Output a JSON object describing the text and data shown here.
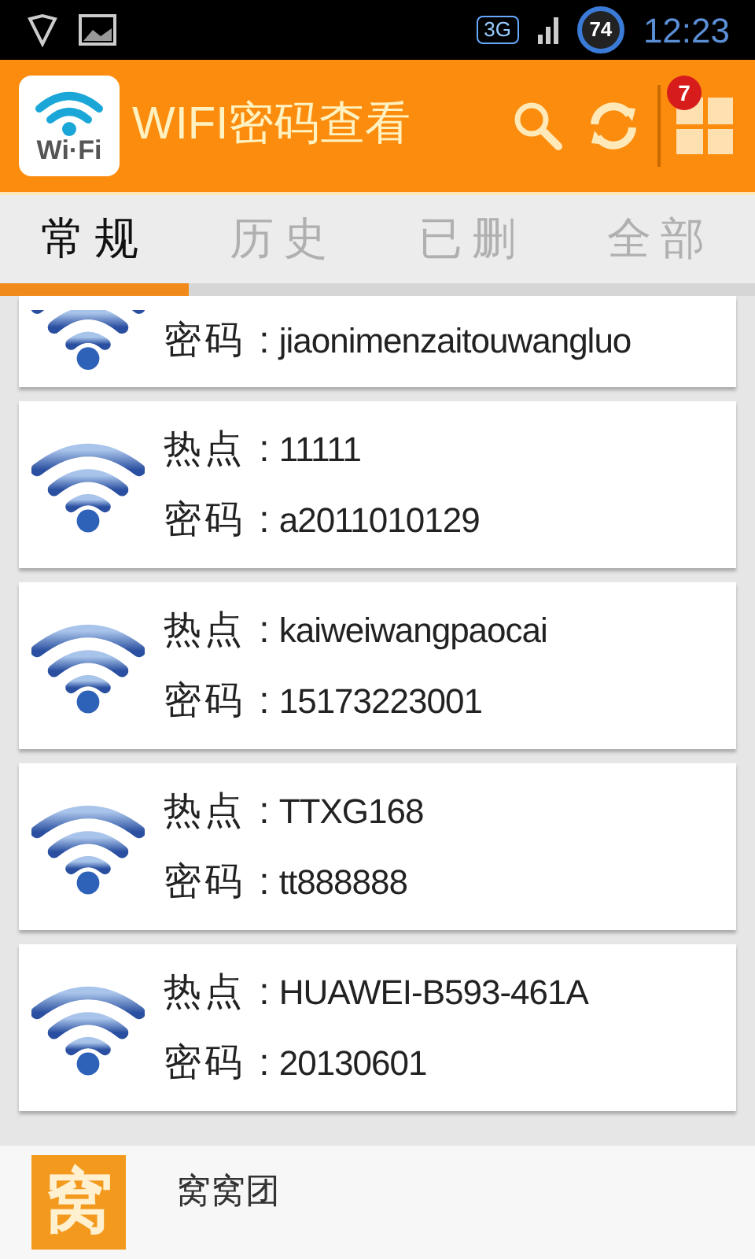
{
  "status_bar": {
    "network": "3G",
    "battery": "74",
    "time": "12:23"
  },
  "header": {
    "logo_text": "Wi·Fi",
    "title": "WIFI密码查看",
    "badge": "7"
  },
  "tabs": [
    {
      "label": "常规",
      "selected": true
    },
    {
      "label": "历史",
      "selected": false
    },
    {
      "label": "已删",
      "selected": false
    },
    {
      "label": "全部",
      "selected": false
    }
  ],
  "entries": [
    {
      "password_label": "密码 :",
      "password": "jiaonimenzaitouwangluo"
    },
    {
      "hotspot_label": "热点 :",
      "hotspot": "11111",
      "password_label": "密码 :",
      "password": "a2011010129"
    },
    {
      "hotspot_label": "热点 :",
      "hotspot": "kaiweiwangpaocai",
      "password_label": "密码 :",
      "password": "15173223001"
    },
    {
      "hotspot_label": "热点 :",
      "hotspot": "TTXG168",
      "password_label": "密码 :",
      "password": "tt888888"
    },
    {
      "hotspot_label": "热点 :",
      "hotspot": "HUAWEI-B593-461A",
      "password_label": "密码 :",
      "password": "20130601"
    }
  ],
  "ad": {
    "logo_char": "窝",
    "name": "窝窝团"
  }
}
